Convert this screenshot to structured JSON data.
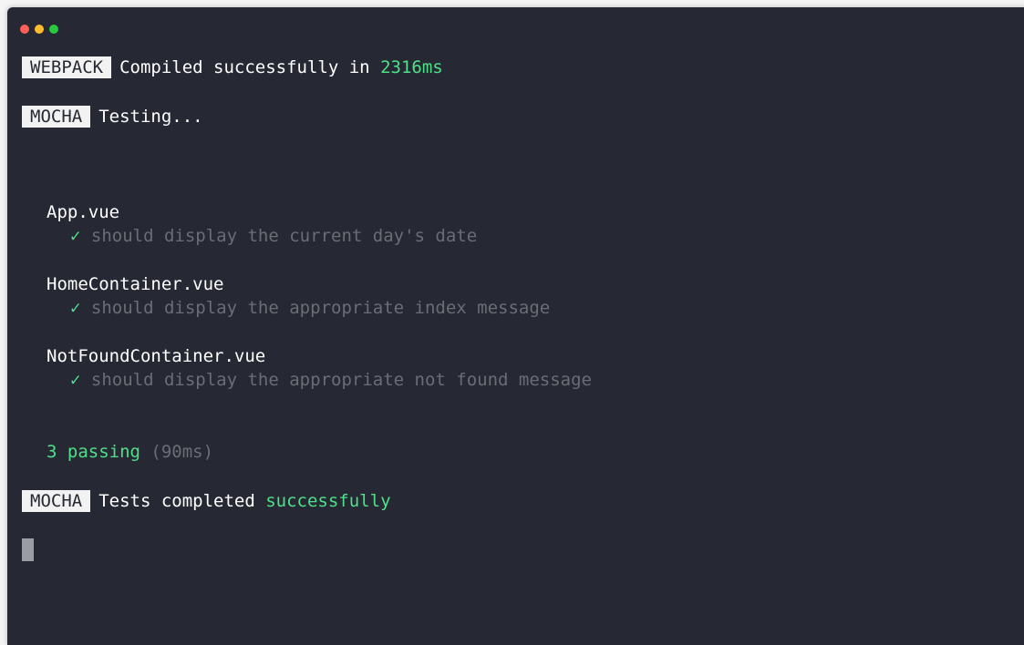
{
  "window": {
    "controls": [
      "close",
      "minimize",
      "maximize"
    ]
  },
  "output": {
    "webpack": {
      "badge": "WEBPACK",
      "message": "Compiled successfully in ",
      "time": "2316ms"
    },
    "mocha_start": {
      "badge": "MOCHA",
      "message": "Testing..."
    },
    "suites": [
      {
        "name": "App.vue",
        "check": "✓",
        "test": "should display the current day's date"
      },
      {
        "name": "HomeContainer.vue",
        "check": "✓",
        "test": "should display the appropriate index message"
      },
      {
        "name": "NotFoundContainer.vue",
        "check": "✓",
        "test": "should display the appropriate not found message"
      }
    ],
    "summary": {
      "passing": "3 passing",
      "duration": "(90ms)"
    },
    "mocha_end": {
      "badge": "MOCHA",
      "message": "Tests completed ",
      "status": "successfully"
    }
  },
  "colors": {
    "background": "#262933",
    "success": "#4ee089",
    "dim": "#6a6d75",
    "badge_bg": "#f2f2f2"
  }
}
